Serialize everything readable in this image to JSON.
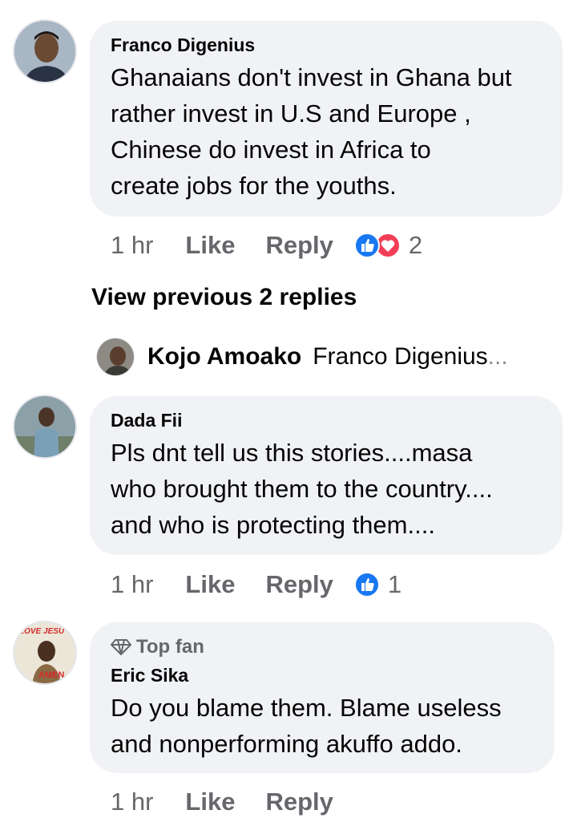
{
  "comments": [
    {
      "author": "Franco Digenius",
      "text_lines": [
        "Ghanaians don't invest in Ghana but",
        "rather invest in U.S and Europe ,",
        "Chinese do invest in Africa to",
        "create jobs for the youths."
      ],
      "time": "1 hr",
      "like_label": "Like",
      "reply_label": "Reply",
      "reactions": [
        "like-icon",
        "love-icon"
      ],
      "reaction_count": "2"
    },
    {
      "author": "Dada Fii",
      "text_lines": [
        "Pls  dnt tell us this stories....masa",
        "who  brought them to the country....",
        "and who is protecting them...."
      ],
      "time": "1 hr",
      "like_label": "Like",
      "reply_label": "Reply",
      "reactions": [
        "like-icon"
      ],
      "reaction_count": "1"
    },
    {
      "badge": "Top fan",
      "author": "Eric Sika",
      "text_lines": [
        "Do you blame them. Blame useless",
        "and nonperforming akuffo addo."
      ],
      "time": "1 hr",
      "like_label": "Like",
      "reply_label": "Reply",
      "avatar_text": {
        "top": "LOVE JESU",
        "bottom": "AMEN"
      }
    }
  ],
  "view_previous": "View previous 2 replies",
  "nested_reply": {
    "author": "Kojo Amoako",
    "preview": "Franco Digenius",
    "ellipsis": "..."
  },
  "colors": {
    "bubble": "#f0f2f5",
    "meta": "#65676b",
    "like_blue": "#1877f2",
    "love_red": "#f33e58"
  }
}
